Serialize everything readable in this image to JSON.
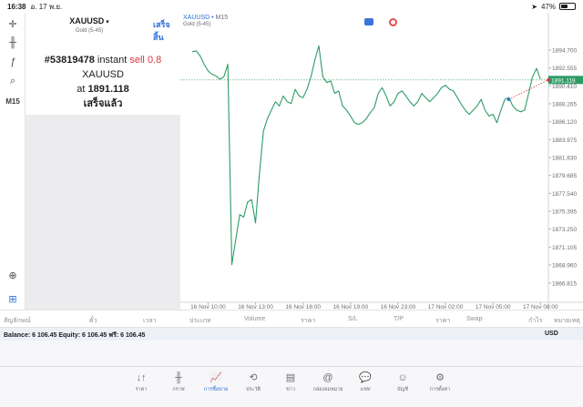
{
  "status": {
    "time": "16:38",
    "date": "อ. 17 พ.ย.",
    "battery": "47%",
    "battery_level": 0.47
  },
  "tools": {
    "timeframe": "M15"
  },
  "order": {
    "symbol": "XAUUSD",
    "symbol_sub": "Gold (5-45)",
    "done_label": "เสร็จสิ้น",
    "msg_id": "#53819478",
    "msg_type": "instant",
    "msg_side": "sell",
    "msg_volume": "0.8",
    "msg_symbol": "XAUUSD",
    "msg_at": "at",
    "msg_price": "1891.118",
    "msg_status": "เสร็จแล้ว"
  },
  "chart_data": {
    "type": "line",
    "title": "XAUUSD",
    "timeframe": "M15",
    "subtitle": "Gold (5-45)",
    "line_color": "#2e9b66",
    "price_color": "#2e9b66",
    "current_price": "1891.118",
    "current_price_value": 1891.118,
    "ylim": [
      1864.5,
      1897.2
    ],
    "yticks": [
      1894.7,
      1892.555,
      1890.41,
      1888.265,
      1886.12,
      1883.975,
      1881.83,
      1879.685,
      1877.54,
      1875.395,
      1873.25,
      1871.105,
      1868.96,
      1866.815
    ],
    "ytick_labels": [
      "1894.700",
      "1892.555",
      "1890.410",
      "1888.265",
      "1886.120",
      "1883.975",
      "1881.830",
      "1879.685",
      "1877.540",
      "1875.395",
      "1873.250",
      "1871.105",
      "1868.960",
      "1866.815"
    ],
    "xtick_labels": [
      "16 Nov 10:00",
      "16 Nov 13:00",
      "16 Nov 16:00",
      "16 Nov 19:00",
      "16 Nov 23:00",
      "17 Nov 02:00",
      "17 Nov 05:00",
      "17 Nov 08:00"
    ],
    "xtick_index": [
      4,
      16,
      28,
      40,
      52,
      64,
      76,
      88
    ],
    "xlim": [
      -3,
      90
    ],
    "values": [
      1894.5,
      1894.6,
      1894.0,
      1893.0,
      1892.2,
      1891.8,
      1891.6,
      1891.2,
      1891.5,
      1893.0,
      1869.0,
      1872.0,
      1875.0,
      1874.7,
      1876.5,
      1876.8,
      1874.0,
      1880.0,
      1885.0,
      1886.5,
      1887.5,
      1888.5,
      1888.0,
      1889.2,
      1888.5,
      1888.3,
      1890.0,
      1889.2,
      1889.0,
      1890.0,
      1891.5,
      1893.5,
      1895.2,
      1891.5,
      1890.8,
      1891.0,
      1889.5,
      1889.8,
      1888.0,
      1887.5,
      1886.8,
      1886.0,
      1885.8,
      1886.0,
      1886.5,
      1887.2,
      1887.8,
      1889.5,
      1890.2,
      1889.2,
      1888.0,
      1888.5,
      1889.5,
      1889.8,
      1889.2,
      1888.5,
      1888.0,
      1888.5,
      1889.5,
      1889.0,
      1888.5,
      1889.0,
      1889.5,
      1890.2,
      1890.5,
      1890.0,
      1889.8,
      1889.0,
      1888.2,
      1887.5,
      1887.0,
      1887.5,
      1888.0,
      1888.8,
      1887.5,
      1886.8,
      1887.0,
      1886.0,
      1887.5,
      1888.8,
      1889.0,
      1888.0,
      1887.5,
      1887.3,
      1887.5,
      1889.5,
      1891.5,
      1892.5,
      1891.2
    ],
    "trade_marker_from": [
      80,
      1888.8
    ],
    "trade_marker_to": [
      90,
      1891.118
    ]
  },
  "columns": [
    "สัญลักษณ์",
    "ตั๋ว",
    "เวลา",
    "ประเภท",
    "Volume",
    "ราคา",
    "S/L",
    "T/P",
    "ราคา",
    "Swap",
    "กำไร",
    "หมายเหตุ"
  ],
  "balance": {
    "text": "Balance: 6 106.45 Equity: 6 106.45 ฟรี: 6 106.45",
    "currency": "USD"
  },
  "tabs": [
    {
      "label": "ราคา",
      "icon": "↓↑"
    },
    {
      "label": "กราฟ",
      "icon": "╫"
    },
    {
      "label": "การซื้อขาย",
      "icon": "📈"
    },
    {
      "label": "ประวัติ",
      "icon": "⟲"
    },
    {
      "label": "ข่าว",
      "icon": "▤"
    },
    {
      "label": "กล่องจดหมาย",
      "icon": "@"
    },
    {
      "label": "แชท",
      "icon": "💬"
    },
    {
      "label": "บัญชี",
      "icon": "☺"
    },
    {
      "label": "การตั้งค่า",
      "icon": "⚙"
    }
  ],
  "colors": {
    "accent": "#2f6fd6",
    "sell": "#d9383a"
  }
}
